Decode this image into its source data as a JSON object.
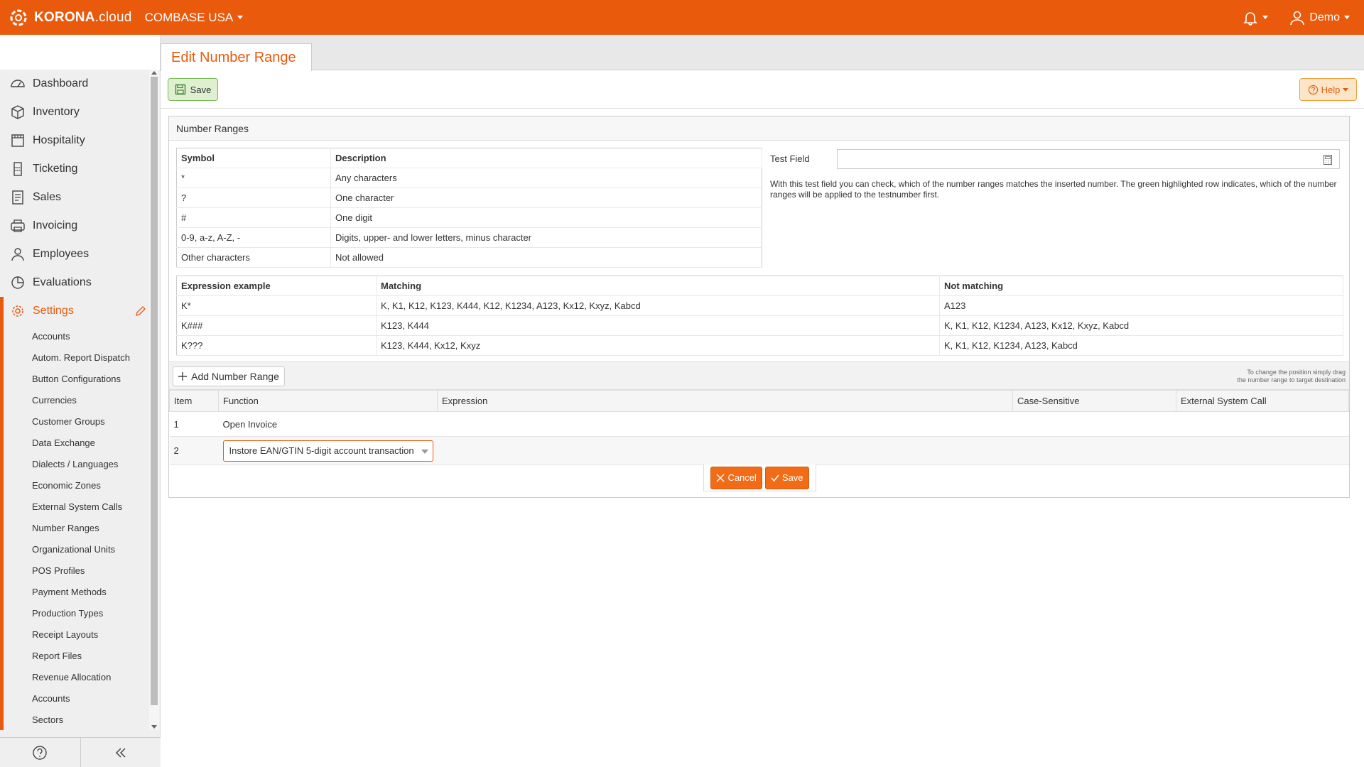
{
  "topbar": {
    "logo_strong": "KORONA",
    "logo_light": ".cloud",
    "organization": "COMBASE USA",
    "user": "Demo"
  },
  "sidebar": {
    "items": [
      {
        "label": "Dashboard",
        "icon": "dashboard-icon"
      },
      {
        "label": "Inventory",
        "icon": "box-icon"
      },
      {
        "label": "Hospitality",
        "icon": "calendar-icon"
      },
      {
        "label": "Ticketing",
        "icon": "ticket-icon"
      },
      {
        "label": "Sales",
        "icon": "receipt-icon"
      },
      {
        "label": "Invoicing",
        "icon": "printer-icon"
      },
      {
        "label": "Employees",
        "icon": "user-icon"
      },
      {
        "label": "Evaluations",
        "icon": "pie-chart-icon"
      },
      {
        "label": "Settings",
        "icon": "gear-icon"
      }
    ],
    "sub_items": [
      "Accounts",
      "Autom. Report Dispatch",
      "Button Configurations",
      "Currencies",
      "Customer Groups",
      "Data Exchange",
      "Dialects / Languages",
      "Economic Zones",
      "External System Calls",
      "Number Ranges",
      "Organizational Units",
      "POS Profiles",
      "Payment Methods",
      "Production Types",
      "Receipt Layouts",
      "Report Files",
      "Revenue Allocation",
      "Accounts",
      "Sectors"
    ]
  },
  "page": {
    "tab_title": "Edit Number Range",
    "save_label": "Save",
    "help_label": "Help"
  },
  "panel": {
    "title": "Number Ranges",
    "symbols": {
      "headers": [
        "Symbol",
        "Description"
      ],
      "rows": [
        [
          "*",
          "Any characters"
        ],
        [
          "?",
          "One character"
        ],
        [
          "#",
          "One digit"
        ],
        [
          "0-9, a-z, A-Z, -",
          "Digits, upper- and lower letters, minus character"
        ],
        [
          "Other characters",
          "Not allowed"
        ]
      ]
    },
    "examples": {
      "headers": [
        "Expression example",
        "Matching",
        "Not matching"
      ],
      "rows": [
        [
          "K*",
          "K, K1, K12, K123, K444, K12, K1234, A123, Kx12, Kxyz, Kabcd",
          "A123"
        ],
        [
          "K###",
          "K123, K444",
          "K, K1, K12, K1234, A123, Kx12, Kxyz, Kabcd"
        ],
        [
          "K???",
          "K123, K444, Kx12, Kxyz",
          "K, K1, K12, K1234, A123, Kabcd"
        ]
      ]
    },
    "test_field": {
      "label": "Test Field",
      "value": "",
      "help": "With this test field you can check, which of the number ranges matches the inserted number. The green highlighted row indicates, which of the number ranges will be applied to the testnumber first."
    },
    "add_label": "Add Number Range",
    "drag_hint_1": "To change the position simply drag",
    "drag_hint_2": "the number range to target destination",
    "columns": [
      "Item",
      "Function",
      "Expression",
      "Case-Sensitive",
      "External System Call"
    ],
    "rows": [
      {
        "item": "1",
        "function": "Open Invoice"
      },
      {
        "item": "2",
        "function": "Instore EAN/GTIN 5-digit account transaction"
      }
    ],
    "cancel_label": "Cancel",
    "save_label": "Save"
  },
  "colors": {
    "brand": "#e95a0c",
    "save_green": "#7ab85a",
    "help_bg": "#fde6c8"
  }
}
